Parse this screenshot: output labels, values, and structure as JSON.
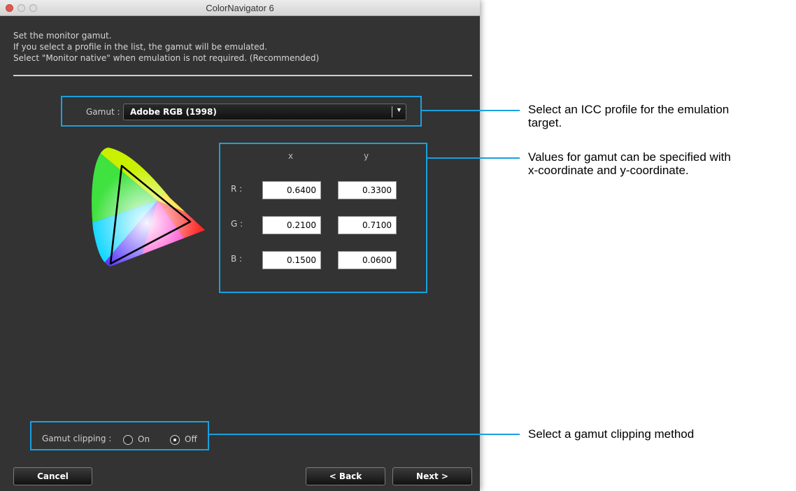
{
  "window": {
    "title": "ColorNavigator 6"
  },
  "intro": {
    "line1": "Set the monitor gamut.",
    "line2": "If you select a profile in the list, the gamut will be emulated.",
    "line3": "Select \"Monitor native\" when emulation is not required. (Recommended)"
  },
  "gamut": {
    "label": "Gamut :",
    "selected": "Adobe RGB (1998)",
    "arrow_icon": "dropdown-arrow-icon"
  },
  "coordinates": {
    "x_header": "x",
    "y_header": "y",
    "rows": [
      {
        "label": "R :",
        "x": "0.6400",
        "y": "0.3300"
      },
      {
        "label": "G :",
        "x": "0.2100",
        "y": "0.7100"
      },
      {
        "label": "B :",
        "x": "0.1500",
        "y": "0.0600"
      }
    ]
  },
  "clipping": {
    "label": "Gamut clipping :",
    "options": [
      {
        "label": "On",
        "selected": false
      },
      {
        "label": "Off",
        "selected": true
      }
    ]
  },
  "buttons": {
    "cancel": "Cancel",
    "back": "< Back",
    "next": "Next >"
  },
  "annotations": {
    "gamut_note_line1": "Select an ICC profile for the emulation",
    "gamut_note_line2": "target.",
    "values_note_line1": "Values for gamut can be specified with",
    "values_note_line2": "x-coordinate and y-coordinate.",
    "clipping_note": "Select a gamut clipping method"
  },
  "colors": {
    "highlight": "#1aa0e0",
    "window_bg": "#333333"
  }
}
